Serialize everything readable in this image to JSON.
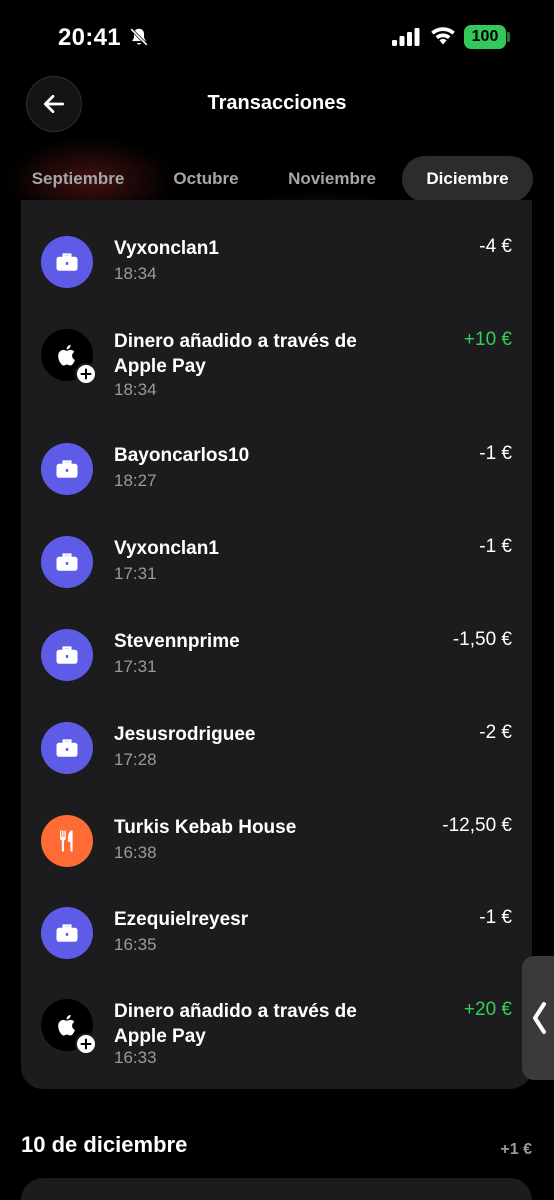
{
  "status_bar": {
    "time": "20:41",
    "battery": "100",
    "icons": [
      "bell-slash-icon",
      "signal-icon",
      "wifi-icon",
      "battery-icon"
    ]
  },
  "header": {
    "title": "Transacciones",
    "back_icon": "arrow-left-icon"
  },
  "tabs": [
    {
      "label": "Septiembre",
      "active": false
    },
    {
      "label": "Octubre",
      "active": false
    },
    {
      "label": "Noviembre",
      "active": false
    },
    {
      "label": "Diciembre",
      "active": true
    }
  ],
  "transactions": [
    {
      "name": "Vyxonclan1",
      "time": "18:34",
      "amount": "-4 €",
      "icon": "briefcase-icon",
      "positive": false
    },
    {
      "name": "Dinero añadido a través de Apple Pay",
      "time": "18:34",
      "amount": "+10 €",
      "icon": "apple-icon",
      "positive": true
    },
    {
      "name": "Bayoncarlos10",
      "time": "18:27",
      "amount": "-1 €",
      "icon": "briefcase-icon",
      "positive": false
    },
    {
      "name": "Vyxonclan1",
      "time": "17:31",
      "amount": "-1 €",
      "icon": "briefcase-icon",
      "positive": false
    },
    {
      "name": "Stevennprime",
      "time": "17:31",
      "amount": "-1,50 €",
      "icon": "briefcase-icon",
      "positive": false
    },
    {
      "name": "Jesusrodriguee",
      "time": "17:28",
      "amount": "-2 €",
      "icon": "briefcase-icon",
      "positive": false
    },
    {
      "name": "Turkis Kebab House",
      "time": "16:38",
      "amount": "-12,50 €",
      "icon": "fork-knife-icon",
      "positive": false
    },
    {
      "name": "Ezequielreyesr",
      "time": "16:35",
      "amount": "-1 €",
      "icon": "briefcase-icon",
      "positive": false
    },
    {
      "name": "Dinero añadido a través de Apple Pay",
      "time": "16:33",
      "amount": "+20 €",
      "icon": "apple-icon",
      "positive": true
    }
  ],
  "section": {
    "title": "10 de diciembre",
    "total": "+1 €"
  },
  "colors": {
    "background": "#000000",
    "card": "#1c1c1e",
    "accent_purple": "#5e5ce6",
    "accent_orange": "#ff6b35",
    "positive_green": "#30d158",
    "battery_green": "#34c759"
  }
}
